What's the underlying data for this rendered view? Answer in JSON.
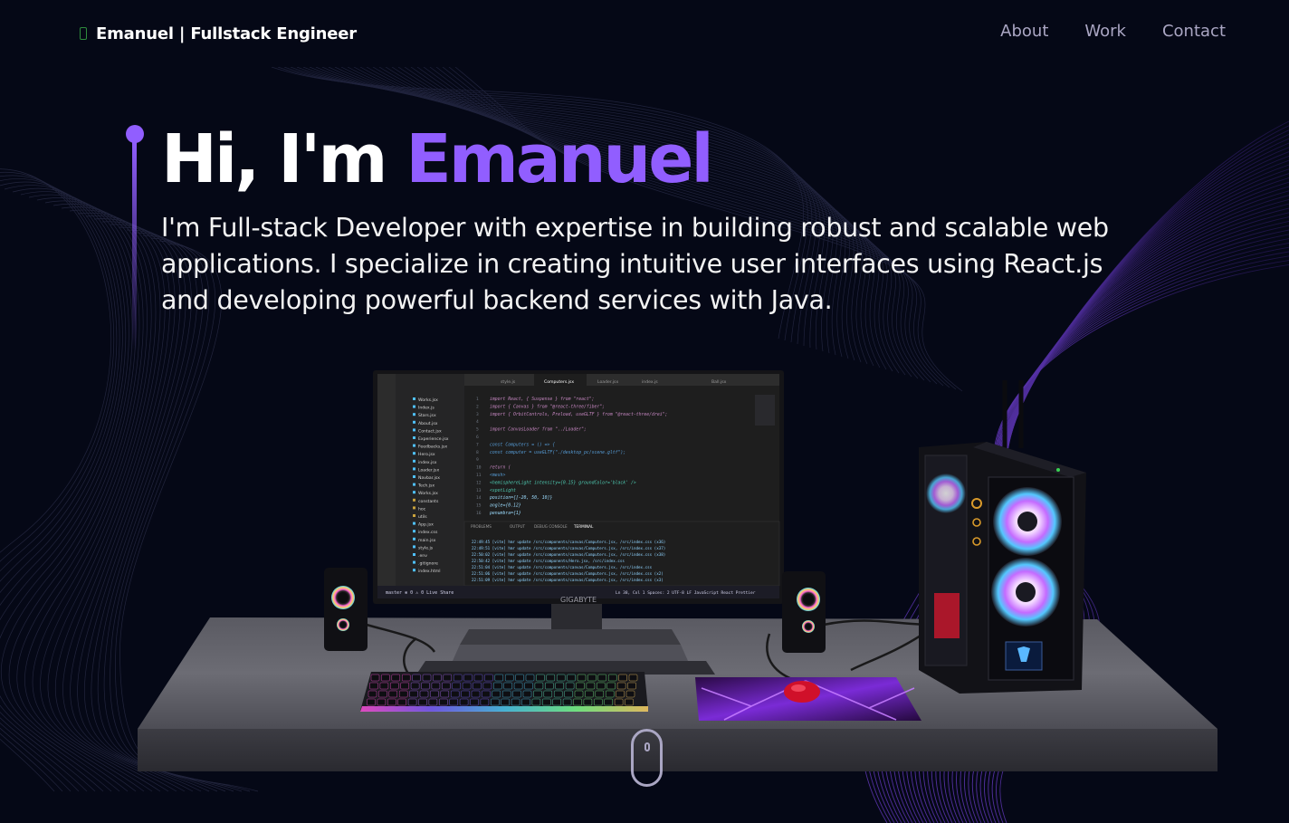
{
  "nav": {
    "logo_text": "Emanuel  | Fullstack Engineer",
    "links": [
      "About",
      "Work",
      "Contact"
    ]
  },
  "hero": {
    "greeting": "Hi, I'm ",
    "name": "Emanuel",
    "description": "I'm Full-stack Developer with expertise in building robust and scalable web applications. I specialize in creating intuitive user interfaces using React.js and developing powerful backend services with Java."
  },
  "monitor": {
    "brand": "GIGABYTE",
    "tabs": [
      "style.js",
      "Computers.jsx",
      "Loader.jsx",
      "index.js",
      "Ball.jsx"
    ],
    "explorer_files": [
      "Works.jsx",
      "Index.js",
      "Stars.jsx",
      "About.jsx",
      "Contact.jsx",
      "Experience.jsx",
      "Feedbacks.jsx",
      "Hero.jsx",
      "index.jsx",
      "Loader.jsx",
      "Navbar.jsx",
      "Tech.jsx",
      "Works.jsx",
      "constants",
      "hoc",
      "utils",
      "App.jsx",
      "index.css",
      "main.jsx",
      "style.js",
      ".env",
      ".gitignore",
      "index.html"
    ],
    "code_lines": [
      "import React, { Suspense } from \"react\";",
      "import { Canvas } from \"@react-three/fiber\";",
      "import { OrbitControls, Preload, useGLTF } from \"@react-three/drei\";",
      "",
      "import CanvasLoader from \"../Loader\";",
      "",
      "const Computers = () => {",
      "  const computer = useGLTF(\"./desktop_pc/scene.gltf\");",
      "",
      "  return (",
      "    <mesh>",
      "      <hemisphereLight intensity={0.15} groundColor='black' />",
      "      <spotLight",
      "        position={[-20, 50, 10]}",
      "        angle={0.12}",
      "        penumbra={1}"
    ],
    "terminal_tabs": [
      "PROBLEMS",
      "OUTPUT",
      "DEBUG CONSOLE",
      "TERMINAL"
    ],
    "terminal_lines": [
      "22:49:45 [vite] hmr update /src/components/canvas/Computers.jsx, /src/index.css (x36)",
      "22:49:51 [vite] hmr update /src/components/canvas/Computers.jsx, /src/index.css (x37)",
      "22:50:02 [vite] hmr update /src/components/canvas/Computers.jsx, /src/index.css (x38)",
      "22:50:42 [vite] hmr update /src/components/Hero.jsx, /src/index.css",
      "22:51:04 [vite] hmr update /src/components/canvas/Computers.jsx, /src/index.css",
      "22:51:06 [vite] hmr update /src/components/canvas/Computers.jsx, /src/index.css (x2)",
      "22:51:09 [vite] hmr update /src/components/canvas/Computers.jsx, /src/index.css (x3)"
    ],
    "status_left": "master  ⊗ 0 ⚠ 0  Live Share",
    "status_right": "Ln 38, Col 1   Spaces: 2   UTF-8   LF   JavaScript React   Prettier"
  },
  "colors": {
    "background": "#050816",
    "accent": "#915eff",
    "nav_text": "#aaa6c3",
    "text": "#ffffff"
  },
  "icons": {
    "scroll": "mouse-scroll-icon",
    "logo": "logo-icon"
  }
}
